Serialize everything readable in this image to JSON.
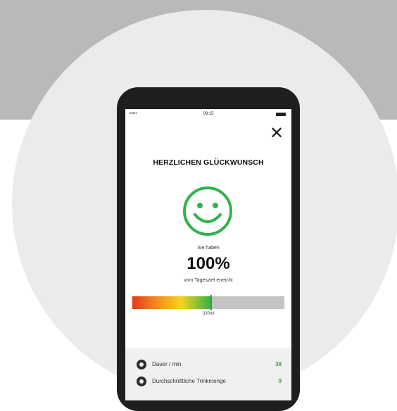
{
  "status_bar": {
    "carrier": "•••••",
    "time": "09:15"
  },
  "close_symbol": "✕",
  "headline": "HERZLICHEN GLÜCKWUNSCH",
  "line1": "Sie haben",
  "percent": "100%",
  "line2": "vom Tagesziel erreicht",
  "progress": {
    "fraction": 0.52,
    "label": "330ml"
  },
  "stats": [
    {
      "icon": "clock-icon",
      "label": "Dauer / min",
      "value": "38"
    },
    {
      "icon": "drop-icon",
      "label": "Durchschnittliche Trinkmenge",
      "value": "9"
    }
  ],
  "colors": {
    "accent_green": "#33b14a",
    "phone_body": "#1e1e1e",
    "circle_bg": "#ebebeb",
    "band_bg": "#b9b9b9"
  }
}
